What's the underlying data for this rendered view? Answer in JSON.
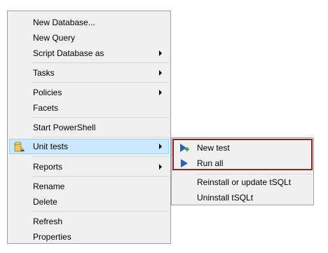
{
  "context_menu": {
    "items": {
      "new_database": {
        "label": "New Database..."
      },
      "new_query": {
        "label": "New Query"
      },
      "script_database_as": {
        "label": "Script Database as"
      },
      "tasks": {
        "label": "Tasks"
      },
      "policies": {
        "label": "Policies"
      },
      "facets": {
        "label": "Facets"
      },
      "start_powershell": {
        "label": "Start PowerShell"
      },
      "unit_tests": {
        "label": "Unit tests",
        "icon": "unit-tests-icon"
      },
      "reports": {
        "label": "Reports"
      },
      "rename": {
        "label": "Rename"
      },
      "delete": {
        "label": "Delete"
      },
      "refresh": {
        "label": "Refresh"
      },
      "properties": {
        "label": "Properties"
      }
    }
  },
  "submenu": {
    "items": {
      "new_test": {
        "label": "New test",
        "icon": "add-test-icon"
      },
      "run_all": {
        "label": "Run all",
        "icon": "play-icon"
      },
      "reinstall": {
        "label": "Reinstall or update tSQLt"
      },
      "uninstall": {
        "label": "Uninstall tSQLt"
      }
    },
    "highlight_color": "#a31621"
  },
  "colors": {
    "menu_background": "#f0f0f0",
    "menu_border": "#a0a0a0",
    "hover_background": "#cce8ff",
    "hover_border": "#99d1ff",
    "separator": "#d7d7d7",
    "play_blue": "#2a62b8"
  }
}
